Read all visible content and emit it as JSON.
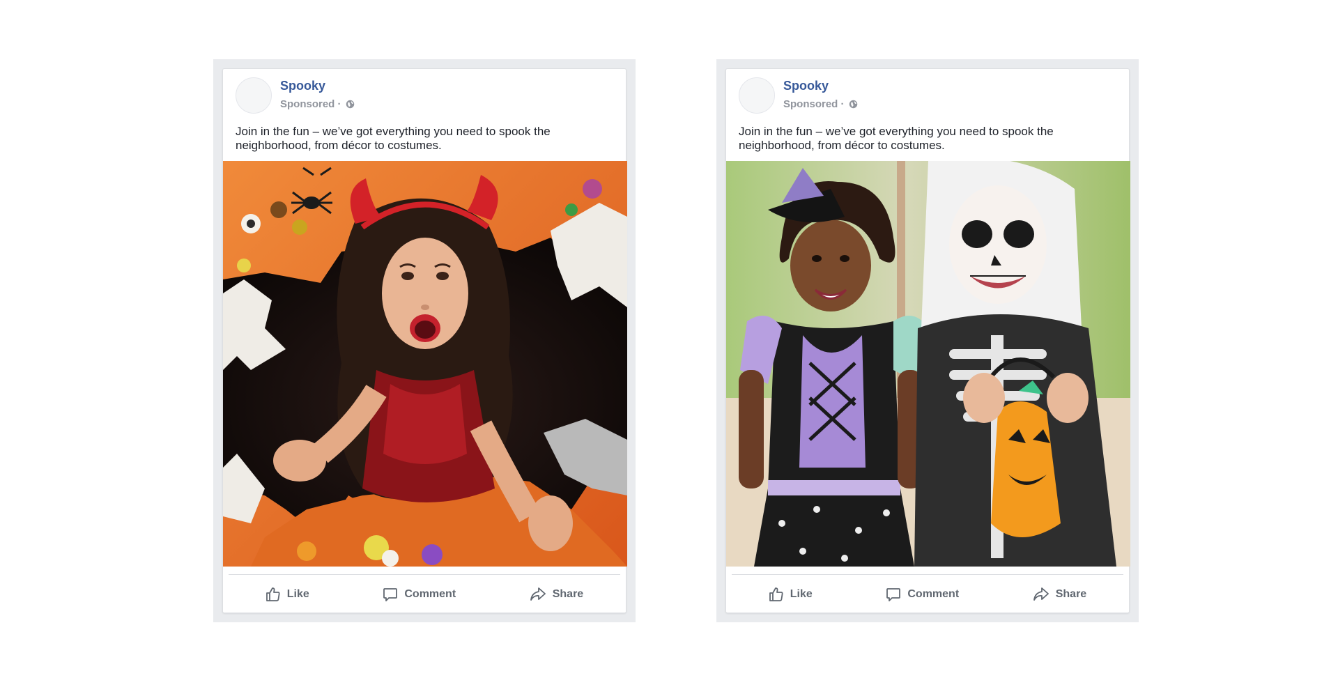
{
  "posts": [
    {
      "page_name": "Spooky",
      "sponsored": "Sponsored ·",
      "text": "Join in the fun – we’ve got everything you need to spook the neighborhood, from décor to costumes.",
      "image_description_icon": "photo-devil-girl",
      "actions": {
        "like": "Like",
        "comment": "Comment",
        "share": "Share"
      }
    },
    {
      "page_name": "Spooky",
      "sponsored": "Sponsored ·",
      "text": "Join in the fun – we’ve got everything you need to spook the neighborhood, from décor to costumes.",
      "image_description_icon": "photo-witch-and-skeleton-kids",
      "actions": {
        "like": "Like",
        "comment": "Comment",
        "share": "Share"
      }
    }
  ],
  "colors": {
    "page_name": "#365899",
    "meta": "#90949c",
    "action": "#606770",
    "frame": "#e9ebee"
  },
  "icons": [
    "globe-icon",
    "like-icon",
    "comment-icon",
    "share-icon"
  ]
}
